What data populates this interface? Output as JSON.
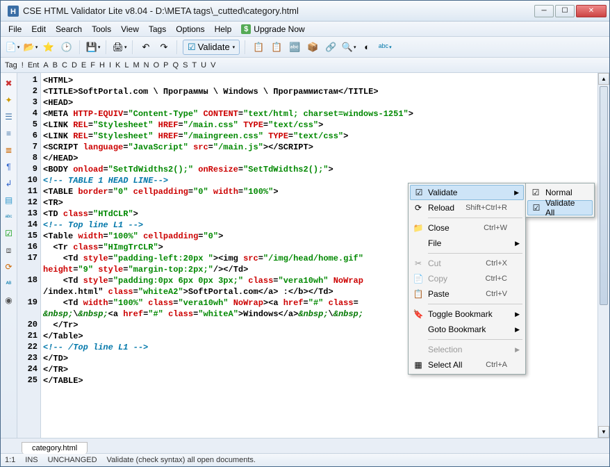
{
  "window": {
    "title": "CSE HTML Validator Lite v8.04 - D:\\META tags\\_cutted\\category.html"
  },
  "menubar": [
    "File",
    "Edit",
    "Search",
    "Tools",
    "View",
    "Tags",
    "Options",
    "Help"
  ],
  "upgrade_label": "Upgrade Now",
  "validate_button": "Validate",
  "tagrow": [
    "Tag",
    "!",
    "Ent",
    "A",
    "B",
    "C",
    "D",
    "E",
    "F",
    "H",
    "I",
    "K",
    "L",
    "M",
    "N",
    "O",
    "P",
    "Q",
    "S",
    "T",
    "U",
    "V"
  ],
  "code_lines": [
    {
      "n": 1,
      "html": "&lt;<b class='t'>HTML</b>&gt;"
    },
    {
      "n": 2,
      "html": "&lt;<b class='t'>TITLE</b>&gt;SoftPortal.com \\ Программы \\ Windows \\ Программистам&lt;/<b class='t'>TITLE</b>&gt;"
    },
    {
      "n": 3,
      "html": "&lt;<b class='t'>HEAD</b>&gt;"
    },
    {
      "n": 4,
      "html": "&lt;<b class='t'>META</b> <b class='a'>HTTP-EQUIV</b>=<b class='v'>\"Content-Type\"</b> <b class='a'>CONTENT</b>=<b class='v'>\"text/html; charset=windows-1251\"</b>&gt;"
    },
    {
      "n": 5,
      "html": "&lt;<b class='t'>LINK</b> <b class='a'>REL</b>=<b class='v'>\"Stylesheet\"</b> <b class='a'>HREF</b>=<b class='v'>\"/main.css\"</b> <b class='a'>TYPE</b>=<b class='v'>\"text/css\"</b>&gt;"
    },
    {
      "n": 6,
      "html": "&lt;<b class='t'>LINK</b> <b class='a'>REL</b>=<b class='v'>\"Stylesheet\"</b> <b class='a'>HREF</b>=<b class='v'>\"/maingreen.css\"</b> <b class='a'>TYPE</b>=<b class='v'>\"text/css\"</b>&gt;"
    },
    {
      "n": 7,
      "html": "&lt;<b class='t'>SCRIPT</b> <b class='a'>language</b>=<b class='v'>\"JavaScript\"</b> <b class='a'>src</b>=<b class='v'>\"/main.js\"</b>&gt;&lt;/<b class='t'>SCRIPT</b>&gt;"
    },
    {
      "n": 8,
      "html": "&lt;/<b class='t'>HEAD</b>&gt;"
    },
    {
      "n": 9,
      "html": "&lt;<b class='t'>BODY</b> <b class='a'>onload</b>=<b class='v'>\"SetTdWidths2();\"</b> <b class='a'>onResize</b>=<b class='v'>\"SetTdWidths2();\"</b>&gt;"
    },
    {
      "n": 10,
      "html": "<span class='c'>&lt;!-- TABLE 1 HEAD LINE--&gt;</span>"
    },
    {
      "n": 11,
      "html": "&lt;<b class='t'>TABLE</b> <b class='a'>border</b>=<b class='v'>\"0\"</b> <b class='a'>cellpadding</b>=<b class='v'>\"0\"</b> <b class='a'>width</b>=<b class='v'>\"100%\"</b>&gt;"
    },
    {
      "n": 12,
      "html": "&lt;<b class='t'>TR</b>&gt;"
    },
    {
      "n": 13,
      "html": "&lt;<b class='t'>TD</b> <b class='a'>class</b>=<b class='v'>\"HTdCLR\"</b>&gt;"
    },
    {
      "n": 14,
      "html": "<span class='c'>&lt;!-- Top line L1 --&gt;</span>"
    },
    {
      "n": 15,
      "html": "&lt;<b class='t'>Table</b> <b class='a'>width</b>=<b class='v'>\"100%\"</b> <b class='a'>cellpadding</b>=<b class='v'>\"0\"</b>&gt;"
    },
    {
      "n": 16,
      "html": "  &lt;<b class='t'>Tr</b> <b class='a'>class</b>=<b class='v'>\"HImgTrCLR\"</b>&gt;"
    },
    {
      "n": 17,
      "html": "    &lt;<b class='t'>Td</b> <b class='a'>style</b>=<b class='v'>\"padding-left:20px \"</b>&gt;&lt;<b class='t'>img</b> <b class='a'>src</b>=<b class='v'>\"/img/head/home.gif\"</b>\n<b class='a'>height</b>=<b class='v'>\"9\"</b> <b class='a'>style</b>=<b class='v'>\"margin-top:2px;\"</b>/&gt;&lt;/<b class='t'>Td</b>&gt;"
    },
    {
      "n": 18,
      "html": "    &lt;<b class='t'>Td</b> <b class='a'>style</b>=<b class='v'>\"padding:0px 6px 0px 3px;\"</b> <b class='a'>class</b>=<b class='v'>\"vera10wh\"</b> <b class='a'>NoWrap</b>\n/index.html\" <b class='a'>class</b>=<b class='v'>\"whiteA2\"</b>&gt;SoftPortal.com&lt;/<b class='t'>a</b>&gt; :&lt;/<b class='t'>b</b>&gt;&lt;/<b class='t'>Td</b>&gt;"
    },
    {
      "n": 19,
      "html": "    &lt;<b class='t'>Td</b> <b class='a'>width</b>=<b class='v'>\"100%\"</b> <b class='a'>class</b>=<b class='v'>\"vera10wh\"</b> <b class='a'>NoWrap</b>&gt;&lt;<b class='t'>a</b> <b class='a'>href</b>=<b class='v'>\"#\"</b> <b class='a'>class</b>=\n<span class='ent'>&amp;nbsp;</span>\\<span class='ent'>&amp;nbsp;</span>&lt;<b class='t'>a</b> <b class='a'>href</b>=<b class='v'>\"#\"</b> <b class='a'>class</b>=<b class='v'>\"whiteA\"</b>&gt;Windows&lt;/<b class='t'>a</b>&gt;<span class='ent'>&amp;nbsp;</span>\\<span class='ent'>&amp;nbsp;</span>"
    },
    {
      "n": 20,
      "html": "  &lt;/<b class='t'>Tr</b>&gt;"
    },
    {
      "n": 21,
      "html": "&lt;/<b class='t'>Table</b>&gt;"
    },
    {
      "n": 22,
      "html": "<span class='c'>&lt;!-- /Top line L1 --&gt;</span>"
    },
    {
      "n": 23,
      "html": "&lt;/<b class='t'>TD</b>&gt;"
    },
    {
      "n": 24,
      "html": "&lt;/<b class='t'>TR</b>&gt;"
    },
    {
      "n": 25,
      "html": "&lt;/<b class='t'>TABLE</b>&gt;"
    }
  ],
  "file_tab": "category.html",
  "status": {
    "pos": "1:1",
    "mode": "INS",
    "state": "UNCHANGED",
    "msg": "Validate (check syntax) all open documents."
  },
  "ctx": {
    "validate": "Validate",
    "reload": "Reload",
    "reload_sc": "Shift+Ctrl+R",
    "close": "Close",
    "close_sc": "Ctrl+W",
    "file": "File",
    "cut": "Cut",
    "cut_sc": "Ctrl+X",
    "copy": "Copy",
    "copy_sc": "Ctrl+C",
    "paste": "Paste",
    "paste_sc": "Ctrl+V",
    "toggle_bm": "Toggle Bookmark",
    "goto_bm": "Goto Bookmark",
    "selection": "Selection",
    "select_all": "Select All",
    "select_all_sc": "Ctrl+A",
    "normal": "Normal",
    "validate_all": "Validate All"
  }
}
